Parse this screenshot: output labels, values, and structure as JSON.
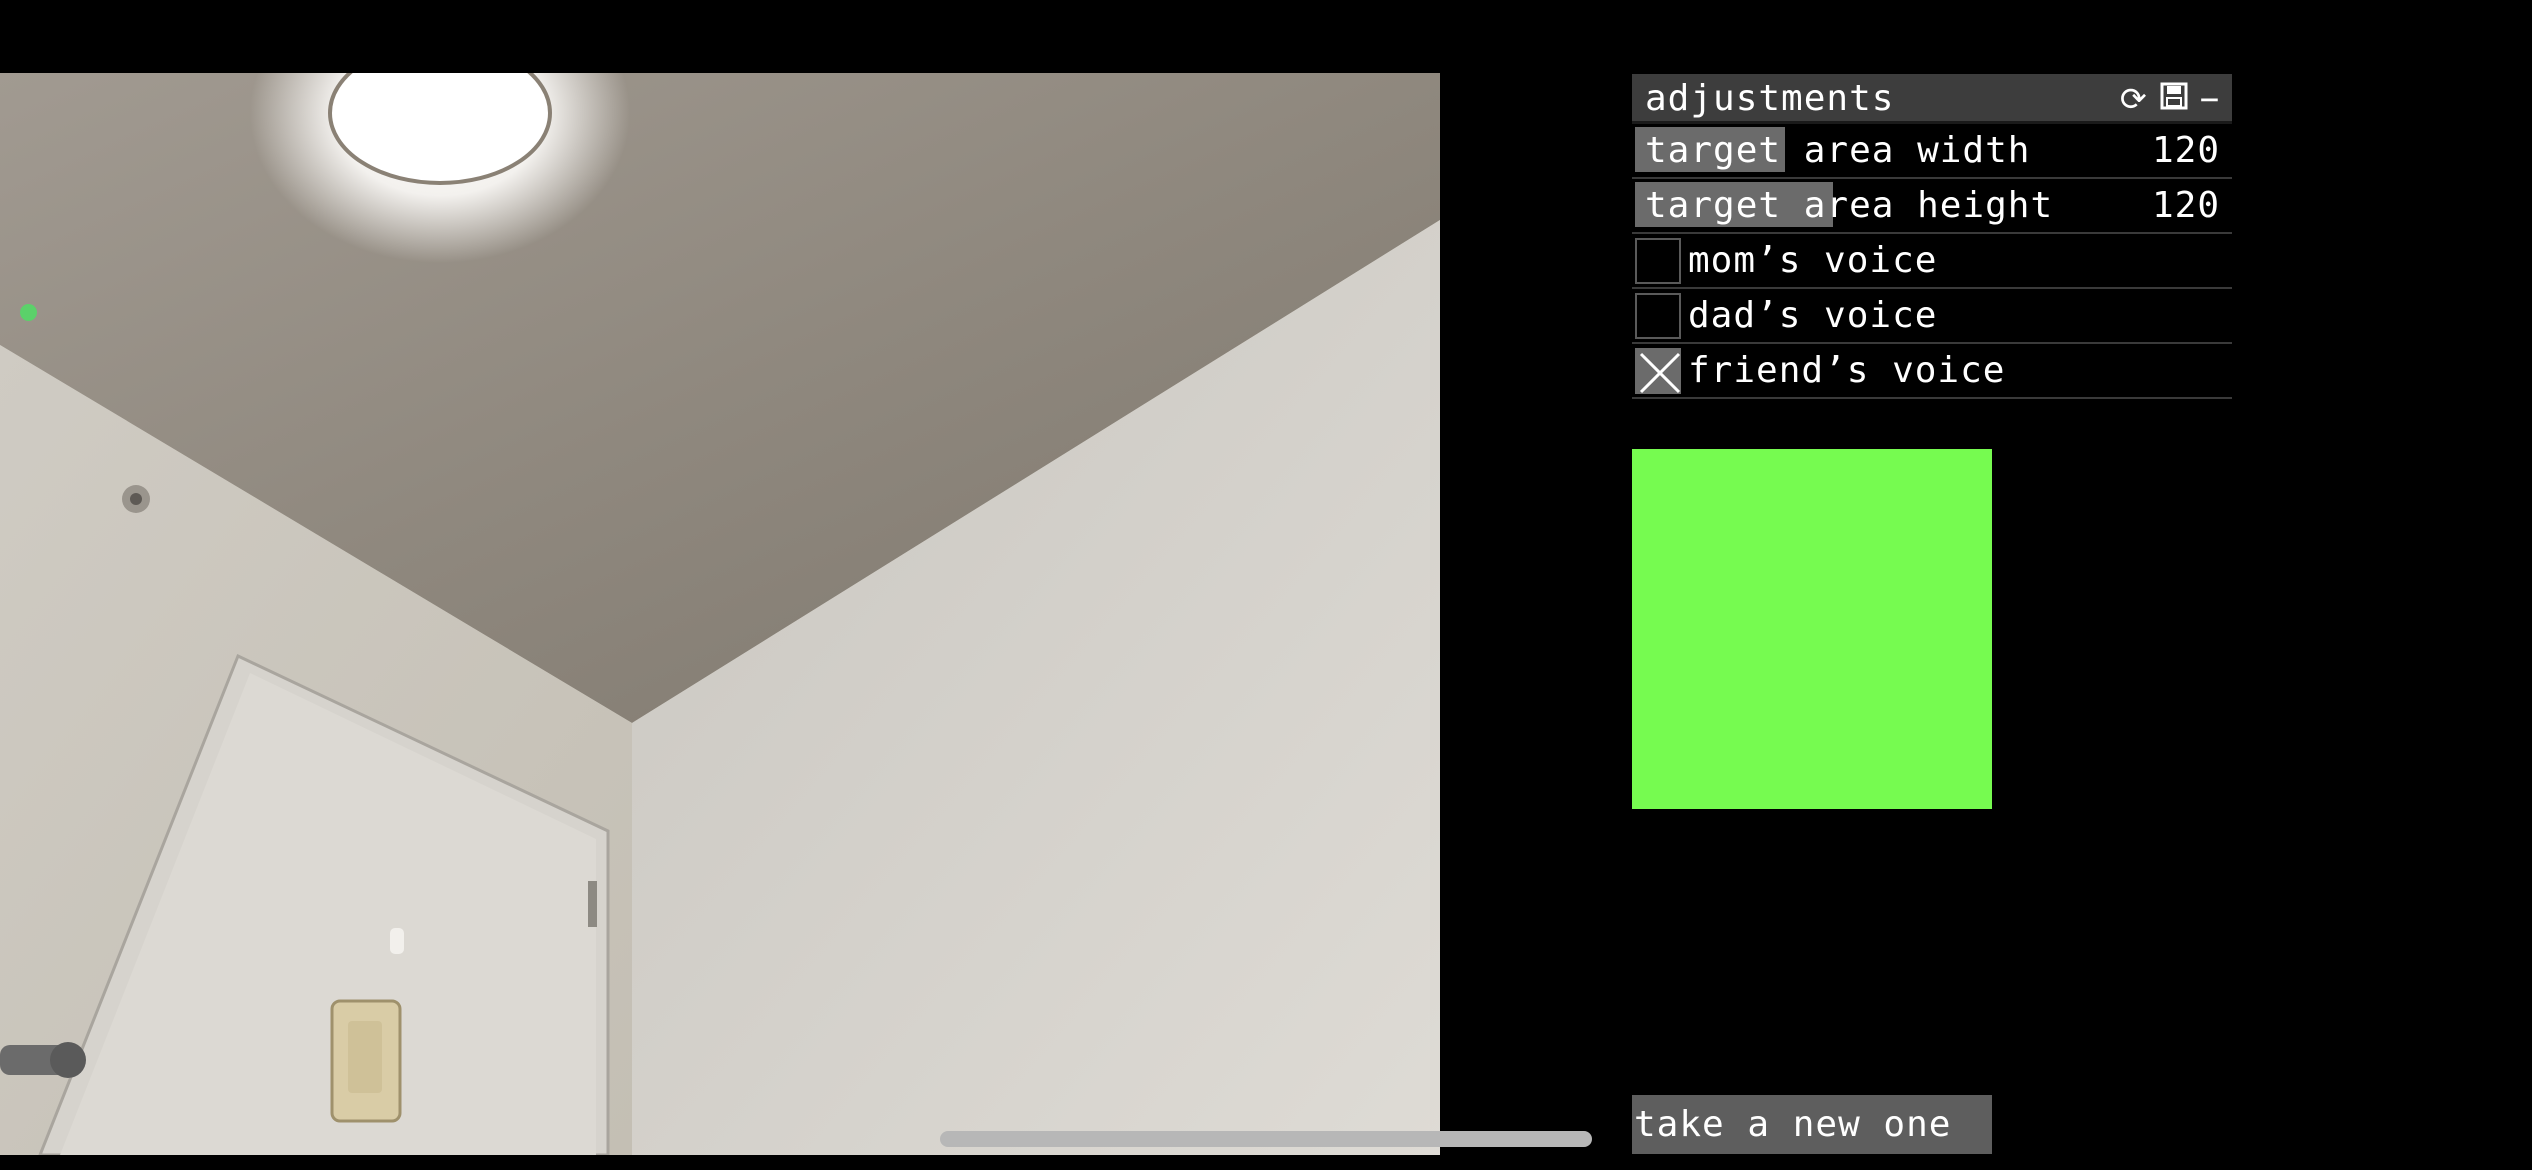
{
  "panel": {
    "title": "adjustments",
    "icons": [
      "refresh-icon",
      "save-icon",
      "minimize-icon"
    ],
    "sliders": [
      {
        "label": "target area width",
        "value": "120",
        "fill_fraction": 0.25
      },
      {
        "label": "target area height",
        "value": "120",
        "fill_fraction": 0.33
      }
    ],
    "checkboxes": [
      {
        "label": "mom’s voice",
        "checked": false
      },
      {
        "label": "dad’s voice",
        "checked": false
      },
      {
        "label": "friend’s voice",
        "checked": true
      }
    ]
  },
  "swatch": {
    "color": "#76fb50"
  },
  "button": {
    "label": "take a new one"
  },
  "indicator": {
    "dot_color": "#5bd16a"
  }
}
